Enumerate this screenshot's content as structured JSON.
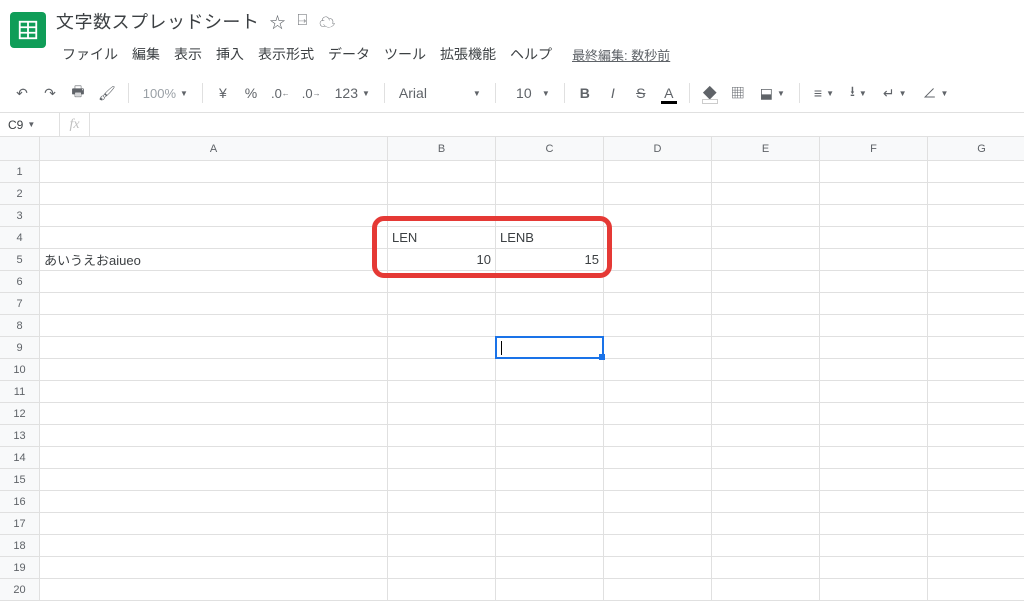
{
  "doc": {
    "title": "文字数スプレッドシート"
  },
  "menubar": {
    "file": "ファイル",
    "edit": "編集",
    "view": "表示",
    "insert": "挿入",
    "format": "表示形式",
    "data": "データ",
    "tools": "ツール",
    "extensions": "拡張機能",
    "help": "ヘルプ",
    "last_edit": "最終編集: 数秒前"
  },
  "toolbar": {
    "zoom": "100%",
    "currency": "¥",
    "percent": "%",
    "dec_dec": ".0",
    "dec_inc": ".00",
    "more_formats": "123",
    "font": "Arial",
    "font_size": "10"
  },
  "namebox": "C9",
  "columns": [
    "A",
    "B",
    "C",
    "D",
    "E",
    "F",
    "G"
  ],
  "rows": [
    "1",
    "2",
    "3",
    "4",
    "5",
    "6",
    "7",
    "8",
    "9",
    "10",
    "11",
    "12",
    "13",
    "14",
    "15",
    "16",
    "17",
    "18",
    "19",
    "20"
  ],
  "cells": {
    "B4": "LEN",
    "C4": "LENB",
    "A5": "あいうえおaiueo",
    "B5": "10",
    "C5": "15"
  }
}
